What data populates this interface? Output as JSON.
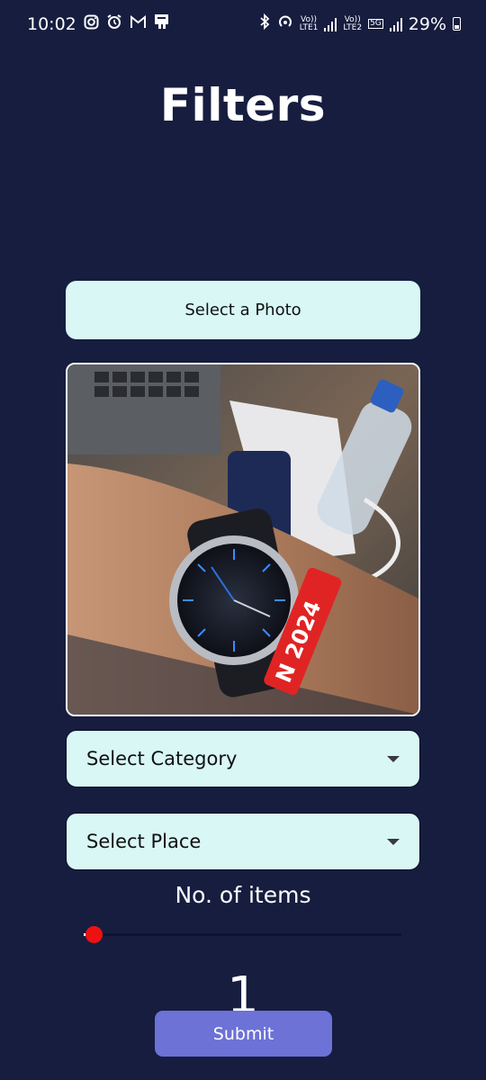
{
  "status_bar": {
    "time": "10:02",
    "battery": "29%",
    "sim1_top": "Vo))",
    "sim1_bottom": "LTE1",
    "sim2_top": "Vo))",
    "sim2_bottom": "LTE2",
    "network": "5G",
    "left_icons": [
      "instagram-icon",
      "alarm-icon",
      "gmail-icon",
      "notification-icon"
    ],
    "right_icons": [
      "bluetooth-icon",
      "hotspot-icon",
      "signal-icon",
      "battery-icon"
    ]
  },
  "title": "Filters",
  "select_photo_label": "Select a Photo",
  "photo": {
    "description_icon": "photo-preview"
  },
  "category_dropdown": {
    "label": "Select Category",
    "icon": "caret-down-icon"
  },
  "place_dropdown": {
    "label": "Select Place",
    "icon": "caret-down-icon"
  },
  "items": {
    "label": "No. of items",
    "value": "1",
    "slider_fraction": 0.0
  },
  "submit_label": "Submit",
  "colors": {
    "background": "#161d3f",
    "button_light": "#d8f7f5",
    "submit": "#6c72d6",
    "slider_thumb": "#ee1111"
  }
}
